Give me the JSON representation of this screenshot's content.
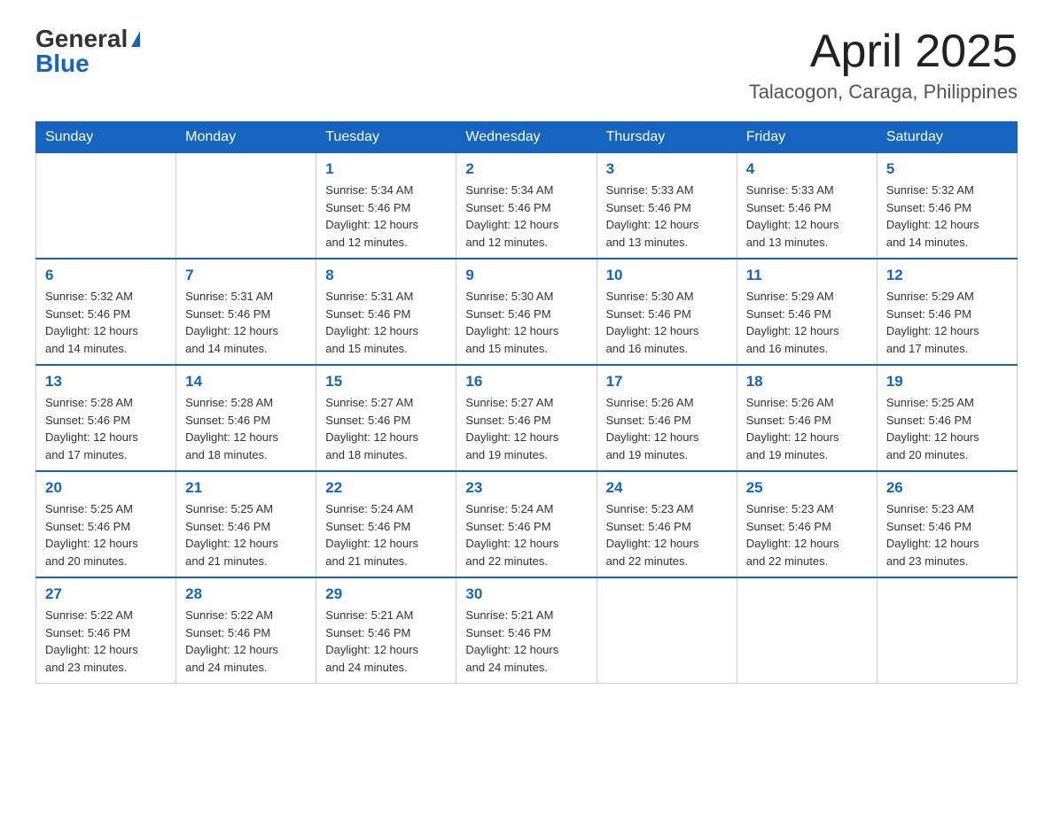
{
  "header": {
    "logo_general": "General",
    "logo_blue": "Blue",
    "month_title": "April 2025",
    "location": "Talacogon, Caraga, Philippines"
  },
  "weekdays": [
    "Sunday",
    "Monday",
    "Tuesday",
    "Wednesday",
    "Thursday",
    "Friday",
    "Saturday"
  ],
  "weeks": [
    [
      {
        "day": "",
        "info": ""
      },
      {
        "day": "",
        "info": ""
      },
      {
        "day": "1",
        "info": "Sunrise: 5:34 AM\nSunset: 5:46 PM\nDaylight: 12 hours\nand 12 minutes."
      },
      {
        "day": "2",
        "info": "Sunrise: 5:34 AM\nSunset: 5:46 PM\nDaylight: 12 hours\nand 12 minutes."
      },
      {
        "day": "3",
        "info": "Sunrise: 5:33 AM\nSunset: 5:46 PM\nDaylight: 12 hours\nand 13 minutes."
      },
      {
        "day": "4",
        "info": "Sunrise: 5:33 AM\nSunset: 5:46 PM\nDaylight: 12 hours\nand 13 minutes."
      },
      {
        "day": "5",
        "info": "Sunrise: 5:32 AM\nSunset: 5:46 PM\nDaylight: 12 hours\nand 14 minutes."
      }
    ],
    [
      {
        "day": "6",
        "info": "Sunrise: 5:32 AM\nSunset: 5:46 PM\nDaylight: 12 hours\nand 14 minutes."
      },
      {
        "day": "7",
        "info": "Sunrise: 5:31 AM\nSunset: 5:46 PM\nDaylight: 12 hours\nand 14 minutes."
      },
      {
        "day": "8",
        "info": "Sunrise: 5:31 AM\nSunset: 5:46 PM\nDaylight: 12 hours\nand 15 minutes."
      },
      {
        "day": "9",
        "info": "Sunrise: 5:30 AM\nSunset: 5:46 PM\nDaylight: 12 hours\nand 15 minutes."
      },
      {
        "day": "10",
        "info": "Sunrise: 5:30 AM\nSunset: 5:46 PM\nDaylight: 12 hours\nand 16 minutes."
      },
      {
        "day": "11",
        "info": "Sunrise: 5:29 AM\nSunset: 5:46 PM\nDaylight: 12 hours\nand 16 minutes."
      },
      {
        "day": "12",
        "info": "Sunrise: 5:29 AM\nSunset: 5:46 PM\nDaylight: 12 hours\nand 17 minutes."
      }
    ],
    [
      {
        "day": "13",
        "info": "Sunrise: 5:28 AM\nSunset: 5:46 PM\nDaylight: 12 hours\nand 17 minutes."
      },
      {
        "day": "14",
        "info": "Sunrise: 5:28 AM\nSunset: 5:46 PM\nDaylight: 12 hours\nand 18 minutes."
      },
      {
        "day": "15",
        "info": "Sunrise: 5:27 AM\nSunset: 5:46 PM\nDaylight: 12 hours\nand 18 minutes."
      },
      {
        "day": "16",
        "info": "Sunrise: 5:27 AM\nSunset: 5:46 PM\nDaylight: 12 hours\nand 19 minutes."
      },
      {
        "day": "17",
        "info": "Sunrise: 5:26 AM\nSunset: 5:46 PM\nDaylight: 12 hours\nand 19 minutes."
      },
      {
        "day": "18",
        "info": "Sunrise: 5:26 AM\nSunset: 5:46 PM\nDaylight: 12 hours\nand 19 minutes."
      },
      {
        "day": "19",
        "info": "Sunrise: 5:25 AM\nSunset: 5:46 PM\nDaylight: 12 hours\nand 20 minutes."
      }
    ],
    [
      {
        "day": "20",
        "info": "Sunrise: 5:25 AM\nSunset: 5:46 PM\nDaylight: 12 hours\nand 20 minutes."
      },
      {
        "day": "21",
        "info": "Sunrise: 5:25 AM\nSunset: 5:46 PM\nDaylight: 12 hours\nand 21 minutes."
      },
      {
        "day": "22",
        "info": "Sunrise: 5:24 AM\nSunset: 5:46 PM\nDaylight: 12 hours\nand 21 minutes."
      },
      {
        "day": "23",
        "info": "Sunrise: 5:24 AM\nSunset: 5:46 PM\nDaylight: 12 hours\nand 22 minutes."
      },
      {
        "day": "24",
        "info": "Sunrise: 5:23 AM\nSunset: 5:46 PM\nDaylight: 12 hours\nand 22 minutes."
      },
      {
        "day": "25",
        "info": "Sunrise: 5:23 AM\nSunset: 5:46 PM\nDaylight: 12 hours\nand 22 minutes."
      },
      {
        "day": "26",
        "info": "Sunrise: 5:23 AM\nSunset: 5:46 PM\nDaylight: 12 hours\nand 23 minutes."
      }
    ],
    [
      {
        "day": "27",
        "info": "Sunrise: 5:22 AM\nSunset: 5:46 PM\nDaylight: 12 hours\nand 23 minutes."
      },
      {
        "day": "28",
        "info": "Sunrise: 5:22 AM\nSunset: 5:46 PM\nDaylight: 12 hours\nand 24 minutes."
      },
      {
        "day": "29",
        "info": "Sunrise: 5:21 AM\nSunset: 5:46 PM\nDaylight: 12 hours\nand 24 minutes."
      },
      {
        "day": "30",
        "info": "Sunrise: 5:21 AM\nSunset: 5:46 PM\nDaylight: 12 hours\nand 24 minutes."
      },
      {
        "day": "",
        "info": ""
      },
      {
        "day": "",
        "info": ""
      },
      {
        "day": "",
        "info": ""
      }
    ]
  ]
}
